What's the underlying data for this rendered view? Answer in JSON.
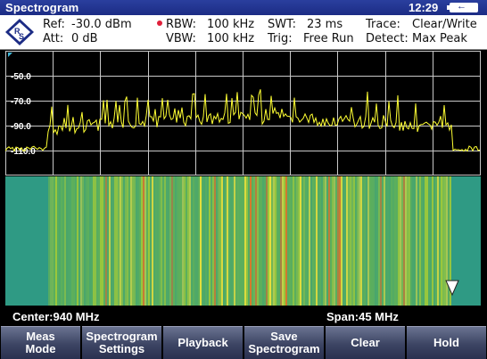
{
  "title_bar": {
    "title": "Spectrogram",
    "clock": "12:29"
  },
  "info": {
    "ref_label": "Ref:",
    "ref_value": "-30.0 dBm",
    "att_label": "Att:",
    "att_value": "0 dB",
    "rbw_label": "RBW:",
    "rbw_value": "100 kHz",
    "vbw_label": "VBW:",
    "vbw_value": "100 kHz",
    "swt_label": "SWT:",
    "swt_value": "23 ms",
    "trig_label": "Trig:",
    "trig_value": "Free Run",
    "trace_label": "Trace:",
    "trace_value": "Clear/Write",
    "detect_label": "Detect:",
    "detect_value": "Max Peak"
  },
  "graph": {
    "y_tick_labels": [
      "-50.0",
      "-70.0",
      "-90.0",
      "-110.0"
    ],
    "trace_color": "#ffff33",
    "grid_color": "#c8c8c8"
  },
  "status": {
    "center": "Center:940 MHz",
    "span": "Span:45 MHz"
  },
  "softkeys": [
    {
      "label": "Meas\nMode"
    },
    {
      "label": "Spectrogram\nSettings"
    },
    {
      "label": "Playback"
    },
    {
      "label": "Save\nSpectrogram"
    },
    {
      "label": "Clear"
    },
    {
      "label": "Hold"
    }
  ],
  "colors": {
    "title_bar": "#1c2c85",
    "waterfall_base": "#2f9a84",
    "marker_dot": "#e0203a"
  }
}
